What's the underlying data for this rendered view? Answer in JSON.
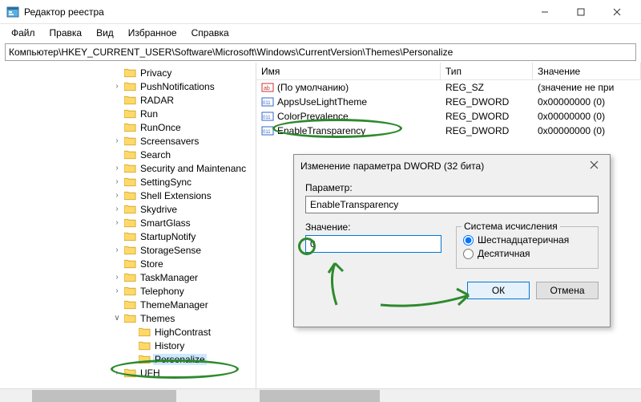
{
  "window": {
    "title": "Редактор реестра"
  },
  "menu": {
    "file": "Файл",
    "edit": "Правка",
    "view": "Вид",
    "favorites": "Избранное",
    "help": "Справка"
  },
  "address": "Компьютер\\HKEY_CURRENT_USER\\Software\\Microsoft\\Windows\\CurrentVersion\\Themes\\Personalize",
  "tree": [
    {
      "label": "Privacy",
      "exp": false,
      "indent": 0
    },
    {
      "label": "PushNotifications",
      "exp": true,
      "indent": 0
    },
    {
      "label": "RADAR",
      "exp": false,
      "indent": 0
    },
    {
      "label": "Run",
      "exp": false,
      "indent": 0
    },
    {
      "label": "RunOnce",
      "exp": false,
      "indent": 0
    },
    {
      "label": "Screensavers",
      "exp": true,
      "indent": 0
    },
    {
      "label": "Search",
      "exp": false,
      "indent": 0
    },
    {
      "label": "Security and Maintenanc",
      "exp": true,
      "indent": 0
    },
    {
      "label": "SettingSync",
      "exp": true,
      "indent": 0
    },
    {
      "label": "Shell Extensions",
      "exp": true,
      "indent": 0
    },
    {
      "label": "Skydrive",
      "exp": true,
      "indent": 0
    },
    {
      "label": "SmartGlass",
      "exp": true,
      "indent": 0
    },
    {
      "label": "StartupNotify",
      "exp": false,
      "indent": 0
    },
    {
      "label": "StorageSense",
      "exp": true,
      "indent": 0
    },
    {
      "label": "Store",
      "exp": false,
      "indent": 0
    },
    {
      "label": "TaskManager",
      "exp": true,
      "indent": 0
    },
    {
      "label": "Telephony",
      "exp": true,
      "indent": 0
    },
    {
      "label": "ThemeManager",
      "exp": false,
      "indent": 0
    },
    {
      "label": "Themes",
      "exp": true,
      "open": true,
      "indent": 0
    },
    {
      "label": "HighContrast",
      "exp": false,
      "indent": 1
    },
    {
      "label": "History",
      "exp": false,
      "indent": 1
    },
    {
      "label": "Personalize",
      "exp": false,
      "indent": 1,
      "selected": true
    },
    {
      "label": "UFH",
      "exp": true,
      "indent": 0
    }
  ],
  "list": {
    "headers": {
      "name": "Имя",
      "type": "Тип",
      "value": "Значение"
    },
    "rows": [
      {
        "name": "(По умолчанию)",
        "type": "REG_SZ",
        "value": "(значение не при",
        "icon": "str"
      },
      {
        "name": "AppsUseLightTheme",
        "type": "REG_DWORD",
        "value": "0x00000000 (0)",
        "icon": "dw"
      },
      {
        "name": "ColorPrevalence",
        "type": "REG_DWORD",
        "value": "0x00000000 (0)",
        "icon": "dw"
      },
      {
        "name": "EnableTransparency",
        "type": "REG_DWORD",
        "value": "0x00000000 (0)",
        "icon": "dw"
      }
    ]
  },
  "dialog": {
    "title": "Изменение параметра DWORD (32 бита)",
    "param_label": "Параметр:",
    "param_value": "EnableTransparency",
    "value_label": "Значение:",
    "value_value": "0",
    "radix_label": "Система исчисления",
    "radix_hex": "Шестнадцатеричная",
    "radix_dec": "Десятичная",
    "ok": "ОК",
    "cancel": "Отмена"
  }
}
